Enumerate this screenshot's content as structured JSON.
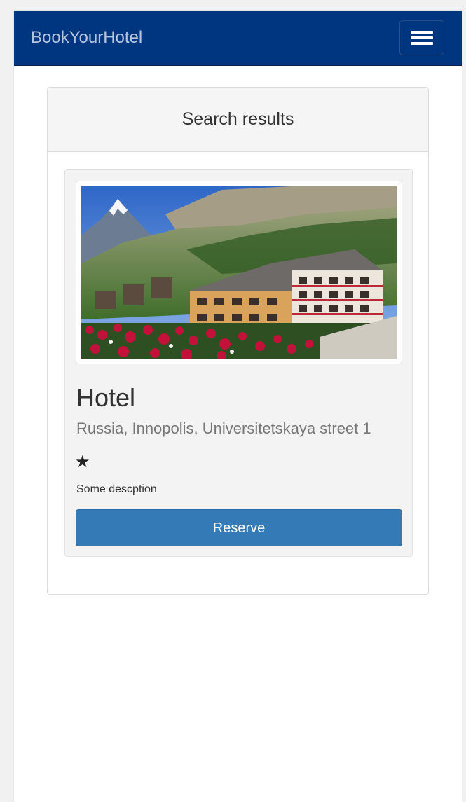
{
  "app": {
    "brand": "BookYourHotel"
  },
  "colors": {
    "navbar": "#00357f",
    "brand_text": "#b7c5dc",
    "primary_button": "#337ab7",
    "panel_heading": "#f5f5f5",
    "card_background": "#f3f3f3"
  },
  "icons": {
    "menu": "hamburger-icon",
    "rating": "star-icon"
  },
  "results": {
    "heading": "Search results",
    "hotels": [
      {
        "name": "Hotel",
        "address": "Russia, Innopolis, Universitetskaya street 1",
        "stars": "★",
        "description": "Some descption",
        "reserve_label": "Reserve"
      }
    ]
  }
}
